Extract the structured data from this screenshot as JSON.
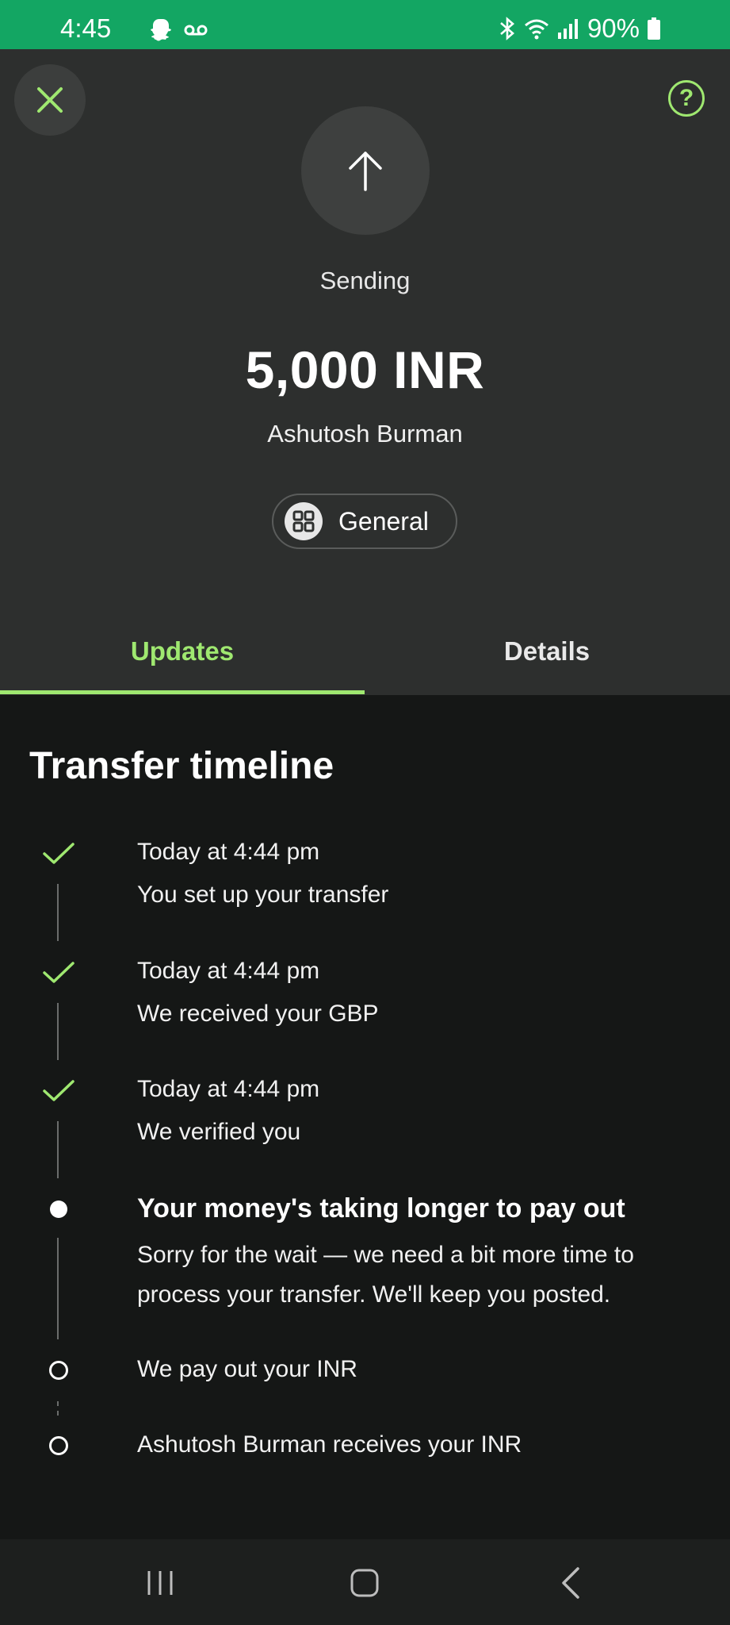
{
  "status_bar": {
    "time": "4:45",
    "battery": "90%"
  },
  "header": {
    "close_icon": "close-icon",
    "help_icon": "help-icon",
    "help_glyph": "?",
    "hero_icon": "arrow-up-icon",
    "status": "Sending",
    "amount": "5,000 INR",
    "recipient": "Ashutosh Burman",
    "category": "General"
  },
  "tabs": [
    {
      "label": "Updates",
      "active": true
    },
    {
      "label": "Details",
      "active": false
    }
  ],
  "timeline": {
    "title": "Transfer timeline",
    "items": [
      {
        "state": "done",
        "time": "Today at 4:44 pm",
        "text": "You set up your transfer"
      },
      {
        "state": "done",
        "time": "Today at 4:44 pm",
        "text": "We received your GBP"
      },
      {
        "state": "done",
        "time": "Today at 4:44 pm",
        "text": "We verified you"
      },
      {
        "state": "current",
        "heading": "Your money's taking longer to pay out",
        "text": "Sorry for the wait — we need a bit more time to process your transfer. We'll keep you posted."
      },
      {
        "state": "pending",
        "text": "We pay out your INR"
      },
      {
        "state": "pending",
        "text": "Ashutosh Burman receives your INR"
      }
    ]
  },
  "colors": {
    "accent": "#9fe870",
    "status_bar": "#13a663",
    "header_bg": "#2d2f2e",
    "body_bg": "#151716"
  }
}
